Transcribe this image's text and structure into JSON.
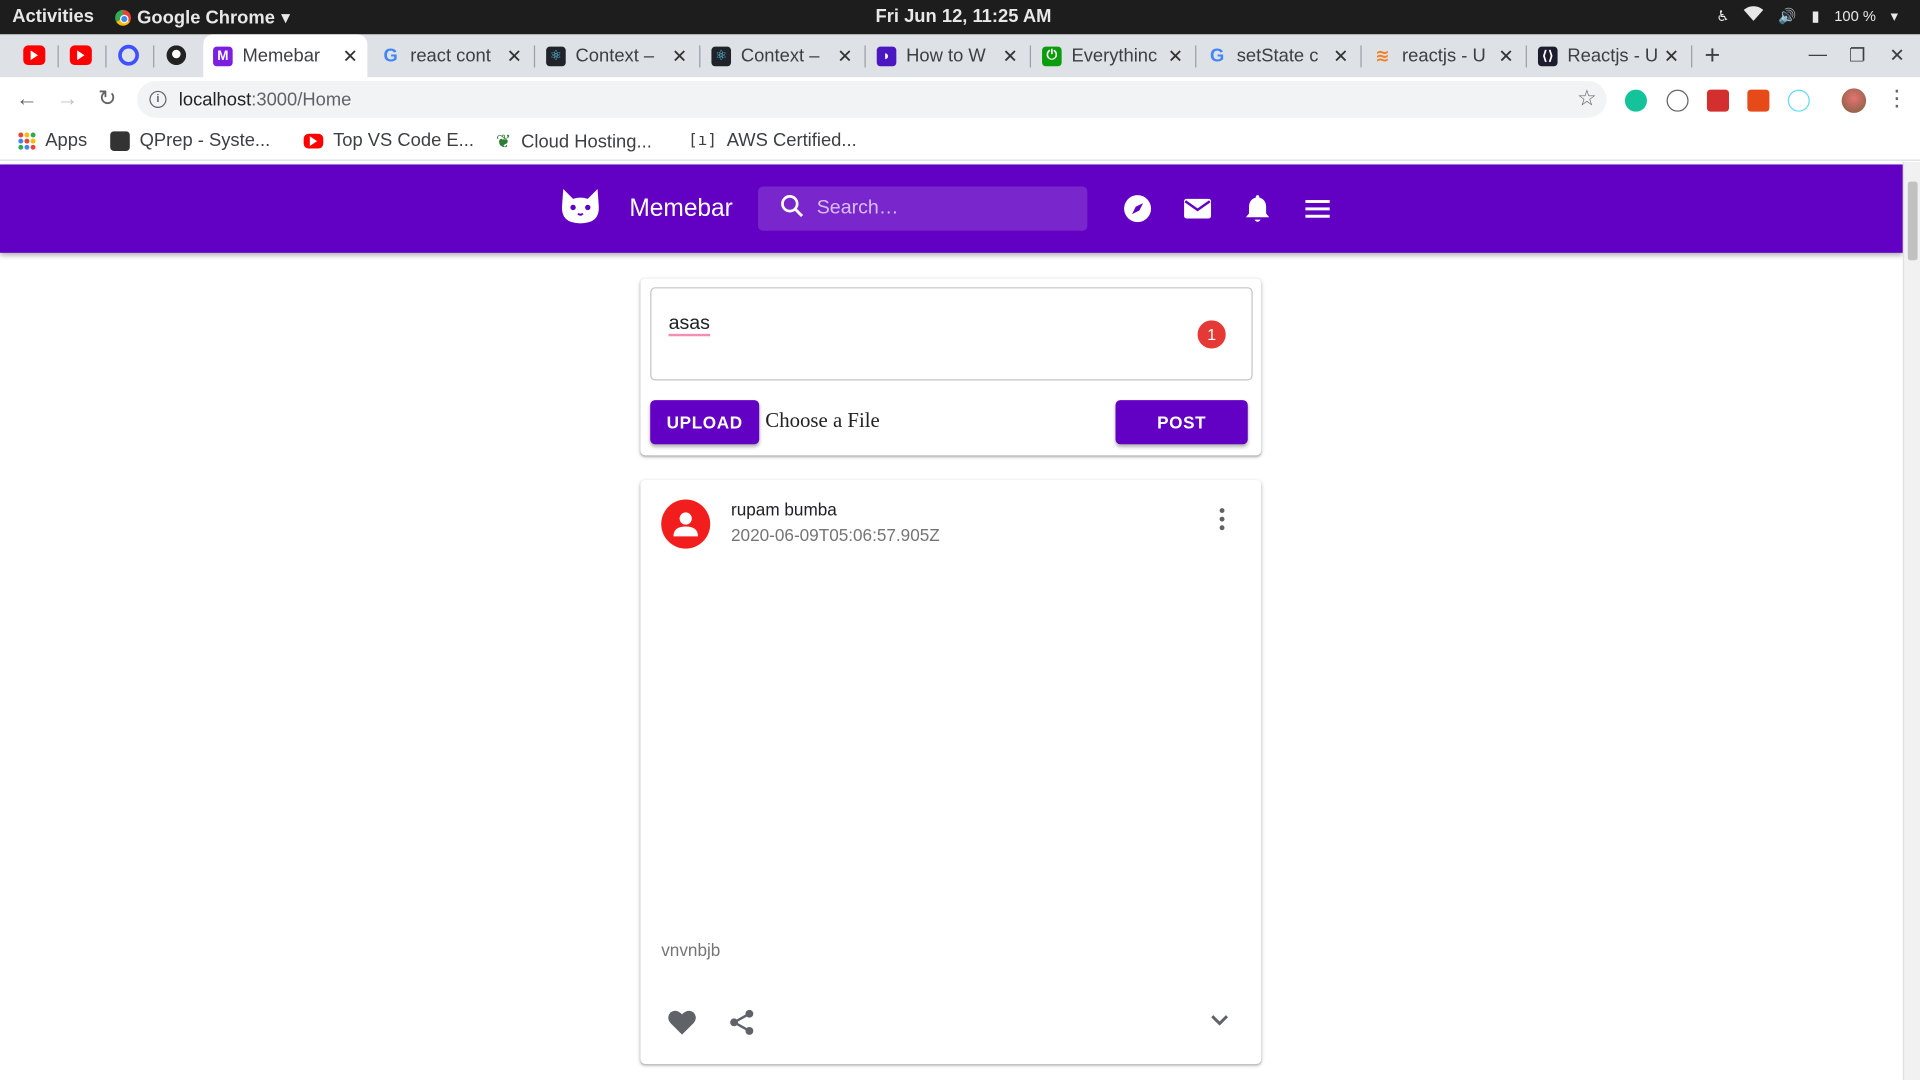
{
  "os_bar": {
    "activities": "Activities",
    "app_name": "Google Chrome",
    "clock": "Fri Jun 12, 11:25 AM",
    "battery": "100 %"
  },
  "tabs": [
    {
      "title": "Memebar",
      "active": true
    },
    {
      "title": "react cont",
      "active": false
    },
    {
      "title": "Context –",
      "active": false
    },
    {
      "title": "Context –",
      "active": false
    },
    {
      "title": "How to W",
      "active": false
    },
    {
      "title": "Everythinc",
      "active": false
    },
    {
      "title": "setState c",
      "active": false
    },
    {
      "title": "reactjs - U",
      "active": false
    },
    {
      "title": "Reactjs - U",
      "active": false
    }
  ],
  "omnibox": {
    "host": "localhost",
    "path": ":3000/Home"
  },
  "bookmarks": [
    {
      "label": "Apps"
    },
    {
      "label": "QPrep - Syste..."
    },
    {
      "label": "Top VS Code E..."
    },
    {
      "label": "Cloud Hosting..."
    },
    {
      "label": "AWS Certified..."
    }
  ],
  "appbar": {
    "brand": "Memebar",
    "search_placeholder": "Search…",
    "icons": [
      "compass-icon",
      "mail-icon",
      "bell-icon",
      "menu-icon"
    ],
    "color": "#6200c4"
  },
  "composer": {
    "text": "asas",
    "badge_count": "1",
    "upload_label": "UPLOAD",
    "file_label": "Choose a File",
    "post_label": "POST"
  },
  "post": {
    "author": "rupam bumba",
    "timestamp": "2020-06-09T05:06:57.905Z",
    "caption": "vnvnbjb",
    "avatar_color": "#f21d1d"
  }
}
